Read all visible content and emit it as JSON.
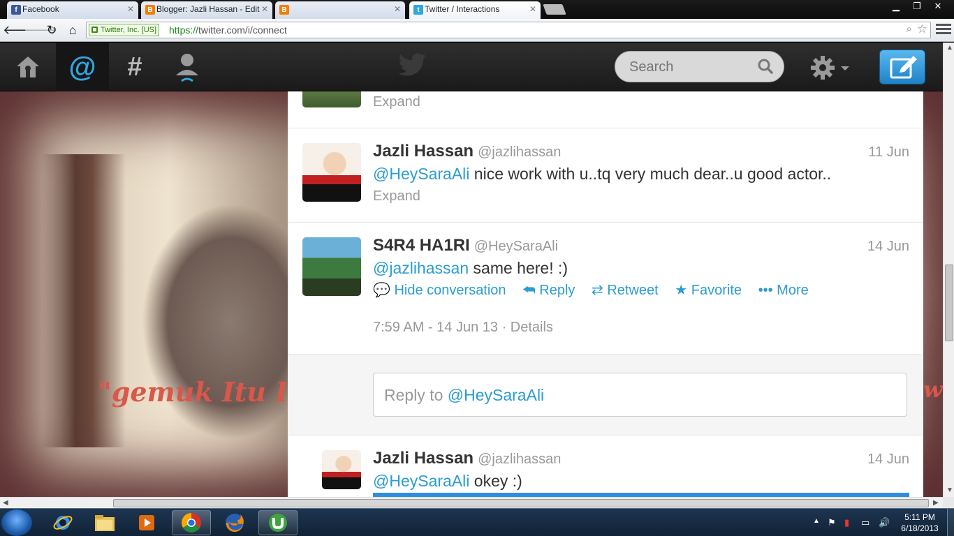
{
  "browser": {
    "tabs": [
      {
        "title": "Facebook",
        "icon": "facebook-icon",
        "color": "#3b5998"
      },
      {
        "title": "Blogger: Jazli Hassan - Edit",
        "icon": "blogger-icon",
        "color": "#f57d00"
      },
      {
        "title": "",
        "icon": "blogger-icon",
        "color": "#f57d00"
      },
      {
        "title": "Twitter / Interactions",
        "icon": "twitter-icon",
        "color": "#2fa7e0"
      }
    ],
    "ev_label": "Twitter, Inc. [US]",
    "url_scheme": "https://",
    "url_rest": "twitter.com/i/connect"
  },
  "twitter": {
    "search_placeholder": "Search",
    "accent": "#2b9dd2"
  },
  "background_text": {
    "left": "\"gemuk Itu I",
    "right": "w"
  },
  "tweets": [
    {
      "expand": "Expand"
    },
    {
      "name": "Jazli Hassan",
      "handle": "@jazlihassan",
      "time": "11 Jun",
      "mention": "@HeySaraAli",
      "text": " nice work with u..tq very much dear..u good actor..",
      "expand": "Expand"
    },
    {
      "name": "S4R4 HA1RI",
      "handle": "@HeySaraAli",
      "time": "14 Jun",
      "mention": "@jazlihassan",
      "text": " same here! :)",
      "actions": {
        "hide": "Hide conversation",
        "reply": "Reply",
        "retweet": "Retweet",
        "favorite": "Favorite",
        "more": "More"
      },
      "timestamp": "7:59 AM - 14 Jun 13",
      "details": "Details"
    },
    {
      "reply_prefix": "Reply to ",
      "reply_mention": "@HeySaraAli"
    },
    {
      "name": "Jazli Hassan",
      "handle": "@jazlihassan",
      "time": "14 Jun",
      "mention": "@HeySaraAli",
      "text": " okey :)"
    }
  ],
  "taskbar": {
    "time": "5:11 PM",
    "date": "6/18/2013"
  }
}
